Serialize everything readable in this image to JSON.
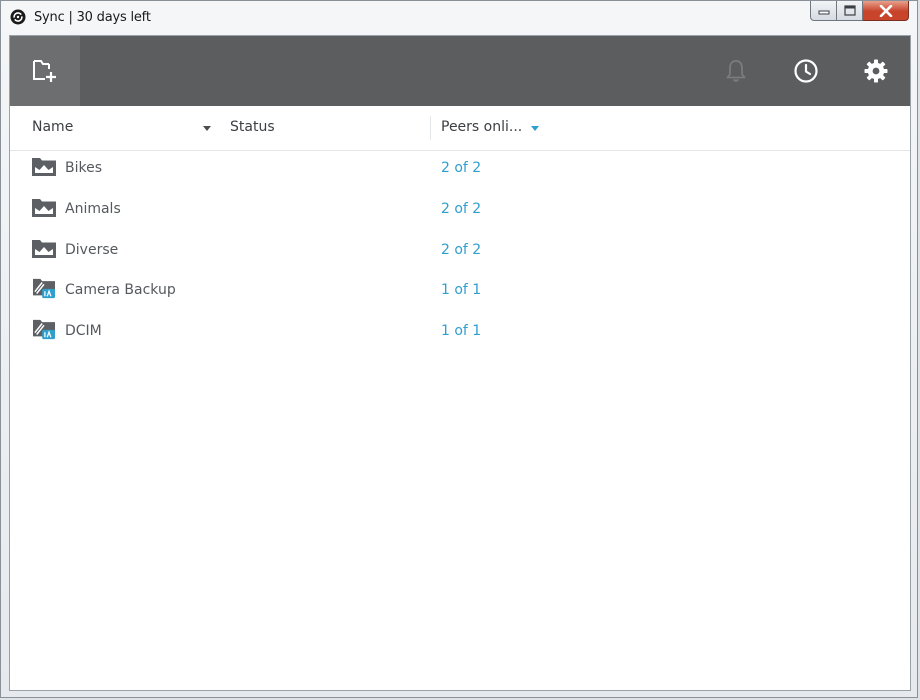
{
  "window": {
    "title": "Sync | 30 days left"
  },
  "toolbar": {
    "add_folder_icon": "add-folder-icon",
    "notifications_icon": "bell-icon",
    "history_icon": "clock-icon",
    "settings_icon": "gear-icon"
  },
  "table": {
    "columns": {
      "name": "Name",
      "status": "Status",
      "peers": "Peers onli..."
    },
    "rows": [
      {
        "name": "Bikes",
        "status": "",
        "peers": "2 of 2",
        "icon": "shared-folder-icon"
      },
      {
        "name": "Animals",
        "status": "",
        "peers": "2 of 2",
        "icon": "shared-folder-icon"
      },
      {
        "name": "Diverse",
        "status": "",
        "peers": "2 of 2",
        "icon": "shared-folder-icon"
      },
      {
        "name": "Camera Backup",
        "status": "",
        "peers": "1 of 1",
        "icon": "camera-backup-icon"
      },
      {
        "name": "DCIM",
        "status": "",
        "peers": "1 of 1",
        "icon": "camera-backup-icon"
      }
    ]
  },
  "colors": {
    "toolbar_bg": "#5c5d5f",
    "accent": "#2f9fce",
    "close_button": "#c7432a"
  }
}
